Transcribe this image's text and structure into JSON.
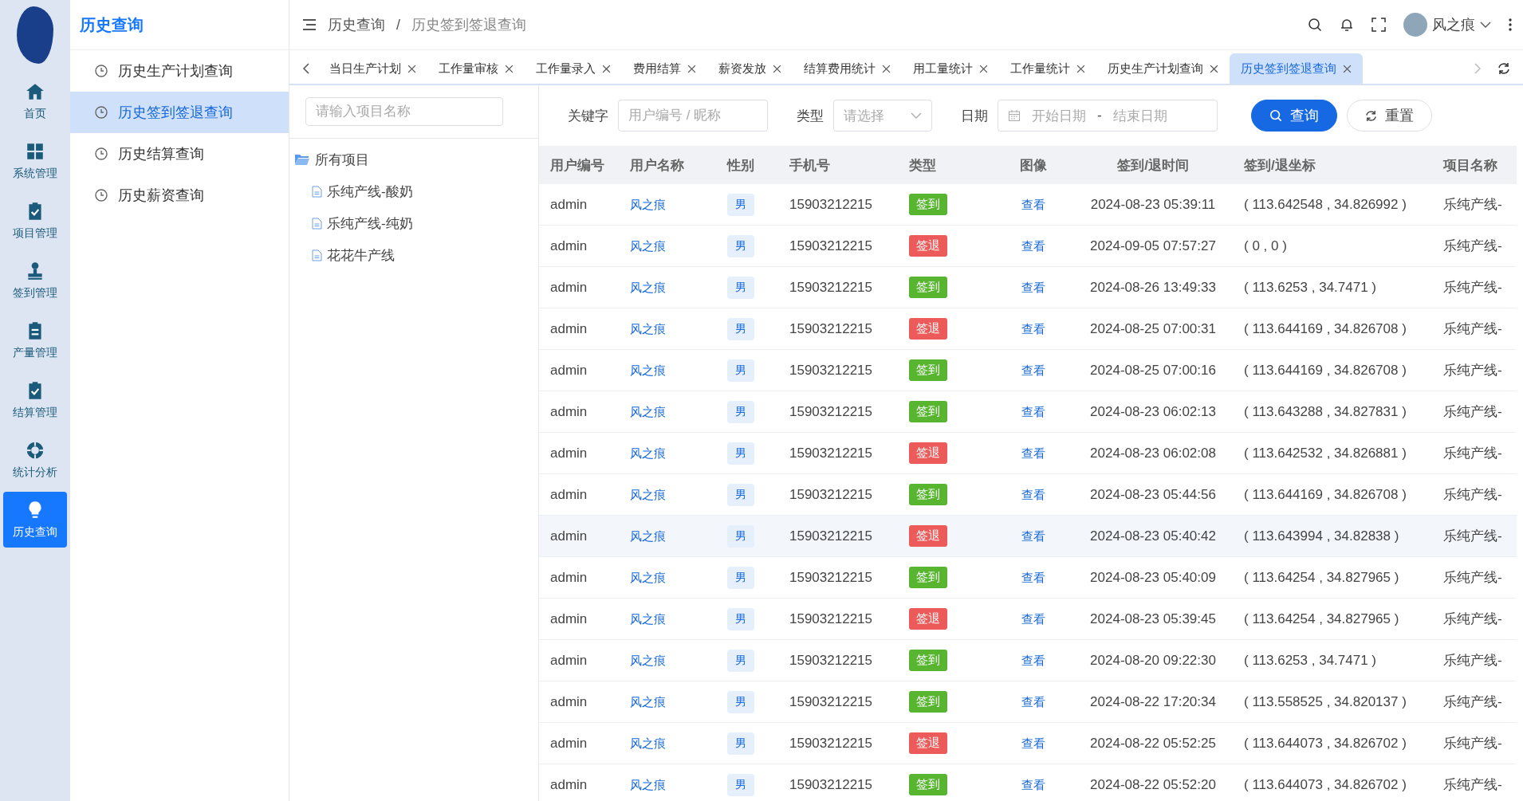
{
  "rail": {
    "items": [
      {
        "label": "首页",
        "selected": false
      },
      {
        "label": "系统管理",
        "selected": false
      },
      {
        "label": "项目管理",
        "selected": false
      },
      {
        "label": "签到管理",
        "selected": false
      },
      {
        "label": "产量管理",
        "selected": false
      },
      {
        "label": "结算管理",
        "selected": false
      },
      {
        "label": "统计分析",
        "selected": false
      },
      {
        "label": "历史查询",
        "selected": true
      }
    ]
  },
  "submenu": {
    "title": "历史查询",
    "items": [
      {
        "label": "历史生产计划查询",
        "selected": false
      },
      {
        "label": "历史签到签退查询",
        "selected": true
      },
      {
        "label": "历史结算查询",
        "selected": false
      },
      {
        "label": "历史薪资查询",
        "selected": false
      }
    ]
  },
  "header": {
    "breadcrumb": [
      "历史查询",
      "历史签到签退查询"
    ],
    "breadcrumb_separator": "/",
    "user_name": "风之痕"
  },
  "tabs": [
    {
      "label": "当日生产计划",
      "selected": false
    },
    {
      "label": "工作量审核",
      "selected": false
    },
    {
      "label": "工作量录入",
      "selected": false
    },
    {
      "label": "费用结算",
      "selected": false
    },
    {
      "label": "薪资发放",
      "selected": false
    },
    {
      "label": "结算费用统计",
      "selected": false
    },
    {
      "label": "用工量统计",
      "selected": false
    },
    {
      "label": "工作量统计",
      "selected": false
    },
    {
      "label": "历史生产计划查询",
      "selected": false
    },
    {
      "label": "历史签到签退查询",
      "selected": true
    }
  ],
  "tree": {
    "search": {
      "placeholder": "请输入项目名称"
    },
    "root": {
      "label": "所有项目",
      "expanded": true,
      "children": [
        {
          "label": "乐纯产线-酸奶"
        },
        {
          "label": "乐纯产线-纯奶"
        },
        {
          "label": "花花牛产线"
        }
      ]
    }
  },
  "filters": {
    "keyword": {
      "label": "关键字",
      "placeholder": "用户编号 / 昵称"
    },
    "type": {
      "label": "类型",
      "placeholder": "请选择"
    },
    "date": {
      "label": "日期",
      "start_placeholder": "开始日期",
      "separator": "-",
      "end_placeholder": "结束日期"
    },
    "search_button": "查询",
    "reset_button": "重置"
  },
  "table": {
    "columns": [
      "用户编号",
      "用户名称",
      "性别",
      "手机号",
      "类型",
      "图像",
      "签到/退时间",
      "签到/退坐标",
      "项目名称"
    ],
    "rows": [
      {
        "user_id": "admin",
        "user_name": "风之痕",
        "gender": "男",
        "phone": "15903212215",
        "type": {
          "label": "签到",
          "kind": "in"
        },
        "image": "查看",
        "time": "2024-08-23 05:39:11",
        "coords": "( 113.642548 , 34.826992 )",
        "project": "乐纯产线-",
        "highlighted": false
      },
      {
        "user_id": "admin",
        "user_name": "风之痕",
        "gender": "男",
        "phone": "15903212215",
        "type": {
          "label": "签退",
          "kind": "out"
        },
        "image": "查看",
        "time": "2024-09-05 07:57:27",
        "coords": "( 0 , 0 )",
        "project": "乐纯产线-",
        "highlighted": false
      },
      {
        "user_id": "admin",
        "user_name": "风之痕",
        "gender": "男",
        "phone": "15903212215",
        "type": {
          "label": "签到",
          "kind": "in"
        },
        "image": "查看",
        "time": "2024-08-26 13:49:33",
        "coords": "( 113.6253 , 34.7471 )",
        "project": "乐纯产线-",
        "highlighted": false
      },
      {
        "user_id": "admin",
        "user_name": "风之痕",
        "gender": "男",
        "phone": "15903212215",
        "type": {
          "label": "签退",
          "kind": "out"
        },
        "image": "查看",
        "time": "2024-08-25 07:00:31",
        "coords": "( 113.644169 , 34.826708 )",
        "project": "乐纯产线-",
        "highlighted": false
      },
      {
        "user_id": "admin",
        "user_name": "风之痕",
        "gender": "男",
        "phone": "15903212215",
        "type": {
          "label": "签到",
          "kind": "in"
        },
        "image": "查看",
        "time": "2024-08-25 07:00:16",
        "coords": "( 113.644169 , 34.826708 )",
        "project": "乐纯产线-",
        "highlighted": false
      },
      {
        "user_id": "admin",
        "user_name": "风之痕",
        "gender": "男",
        "phone": "15903212215",
        "type": {
          "label": "签到",
          "kind": "in"
        },
        "image": "查看",
        "time": "2024-08-23 06:02:13",
        "coords": "( 113.643288 , 34.827831 )",
        "project": "乐纯产线-",
        "highlighted": false
      },
      {
        "user_id": "admin",
        "user_name": "风之痕",
        "gender": "男",
        "phone": "15903212215",
        "type": {
          "label": "签退",
          "kind": "out"
        },
        "image": "查看",
        "time": "2024-08-23 06:02:08",
        "coords": "( 113.642532 , 34.826881 )",
        "project": "乐纯产线-",
        "highlighted": false
      },
      {
        "user_id": "admin",
        "user_name": "风之痕",
        "gender": "男",
        "phone": "15903212215",
        "type": {
          "label": "签到",
          "kind": "in"
        },
        "image": "查看",
        "time": "2024-08-23 05:44:56",
        "coords": "( 113.644169 , 34.826708 )",
        "project": "乐纯产线-",
        "highlighted": false
      },
      {
        "user_id": "admin",
        "user_name": "风之痕",
        "gender": "男",
        "phone": "15903212215",
        "type": {
          "label": "签退",
          "kind": "out"
        },
        "image": "查看",
        "time": "2024-08-23 05:40:42",
        "coords": "( 113.643994 , 34.82838 )",
        "project": "乐纯产线-",
        "highlighted": true
      },
      {
        "user_id": "admin",
        "user_name": "风之痕",
        "gender": "男",
        "phone": "15903212215",
        "type": {
          "label": "签到",
          "kind": "in"
        },
        "image": "查看",
        "time": "2024-08-23 05:40:09",
        "coords": "( 113.64254 , 34.827965 )",
        "project": "乐纯产线-",
        "highlighted": false
      },
      {
        "user_id": "admin",
        "user_name": "风之痕",
        "gender": "男",
        "phone": "15903212215",
        "type": {
          "label": "签退",
          "kind": "out"
        },
        "image": "查看",
        "time": "2024-08-23 05:39:45",
        "coords": "( 113.64254 , 34.827965 )",
        "project": "乐纯产线-",
        "highlighted": false
      },
      {
        "user_id": "admin",
        "user_name": "风之痕",
        "gender": "男",
        "phone": "15903212215",
        "type": {
          "label": "签到",
          "kind": "in"
        },
        "image": "查看",
        "time": "2024-08-20 09:22:30",
        "coords": "( 113.6253 , 34.7471 )",
        "project": "乐纯产线-",
        "highlighted": false
      },
      {
        "user_id": "admin",
        "user_name": "风之痕",
        "gender": "男",
        "phone": "15903212215",
        "type": {
          "label": "签到",
          "kind": "in"
        },
        "image": "查看",
        "time": "2024-08-22 17:20:34",
        "coords": "( 113.558525 , 34.820137 )",
        "project": "乐纯产线-",
        "highlighted": false
      },
      {
        "user_id": "admin",
        "user_name": "风之痕",
        "gender": "男",
        "phone": "15903212215",
        "type": {
          "label": "签退",
          "kind": "out"
        },
        "image": "查看",
        "time": "2024-08-22 05:52:25",
        "coords": "( 113.644073 , 34.826702 )",
        "project": "乐纯产线-",
        "highlighted": false
      },
      {
        "user_id": "admin",
        "user_name": "风之痕",
        "gender": "男",
        "phone": "15903212215",
        "type": {
          "label": "签到",
          "kind": "in"
        },
        "image": "查看",
        "time": "2024-08-22 05:52:20",
        "coords": "( 113.644073 , 34.826702 )",
        "project": "乐纯产线-",
        "highlighted": false
      }
    ]
  }
}
